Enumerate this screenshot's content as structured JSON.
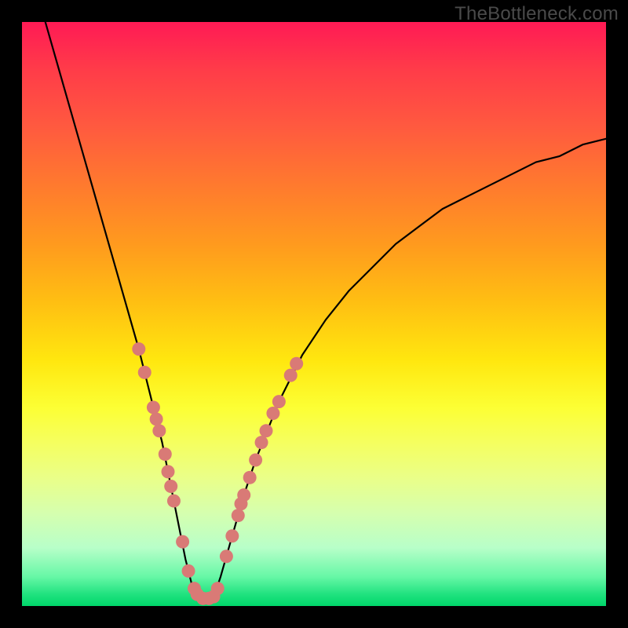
{
  "watermark": "TheBottleneck.com",
  "chart_data": {
    "type": "line",
    "title": "",
    "xlabel": "",
    "ylabel": "",
    "xlim": [
      0,
      100
    ],
    "ylim": [
      0,
      100
    ],
    "grid": false,
    "legend": null,
    "series": [
      {
        "name": "bottleneck-curve",
        "x": [
          4,
          6,
          8,
          10,
          12,
          14,
          16,
          18,
          20,
          22,
          24,
          25,
          26,
          27,
          28,
          29,
          30,
          31,
          32,
          33,
          34,
          36,
          38,
          40,
          44,
          48,
          52,
          56,
          60,
          64,
          68,
          72,
          76,
          80,
          84,
          88,
          92,
          96,
          100
        ],
        "y": [
          100,
          93,
          86,
          79,
          72,
          65,
          58,
          51,
          44,
          36,
          28,
          23,
          18,
          13,
          8,
          4,
          2,
          1,
          1,
          2,
          5,
          12,
          19,
          25,
          35,
          43,
          49,
          54,
          58,
          62,
          65,
          68,
          70,
          72,
          74,
          76,
          77,
          79,
          80
        ]
      }
    ],
    "scatter_points": {
      "name": "highlighted-points",
      "color": "#d97a76",
      "points": [
        {
          "x": 20.0,
          "y": 44
        },
        {
          "x": 21.0,
          "y": 40
        },
        {
          "x": 22.5,
          "y": 34
        },
        {
          "x": 23.0,
          "y": 32
        },
        {
          "x": 23.5,
          "y": 30
        },
        {
          "x": 24.5,
          "y": 26
        },
        {
          "x": 25.0,
          "y": 23
        },
        {
          "x": 25.5,
          "y": 20.5
        },
        {
          "x": 26.0,
          "y": 18
        },
        {
          "x": 27.5,
          "y": 11
        },
        {
          "x": 28.5,
          "y": 6
        },
        {
          "x": 29.5,
          "y": 3
        },
        {
          "x": 30.0,
          "y": 2
        },
        {
          "x": 31.0,
          "y": 1.3
        },
        {
          "x": 32.0,
          "y": 1.3
        },
        {
          "x": 32.8,
          "y": 1.6
        },
        {
          "x": 33.5,
          "y": 3
        },
        {
          "x": 35.0,
          "y": 8.5
        },
        {
          "x": 36.0,
          "y": 12
        },
        {
          "x": 37.0,
          "y": 15.5
        },
        {
          "x": 37.5,
          "y": 17.5
        },
        {
          "x": 38.0,
          "y": 19
        },
        {
          "x": 39.0,
          "y": 22
        },
        {
          "x": 40.0,
          "y": 25
        },
        {
          "x": 41.0,
          "y": 28
        },
        {
          "x": 41.8,
          "y": 30
        },
        {
          "x": 43.0,
          "y": 33
        },
        {
          "x": 44.0,
          "y": 35
        },
        {
          "x": 46.0,
          "y": 39.5
        },
        {
          "x": 47.0,
          "y": 41.5
        }
      ]
    }
  }
}
